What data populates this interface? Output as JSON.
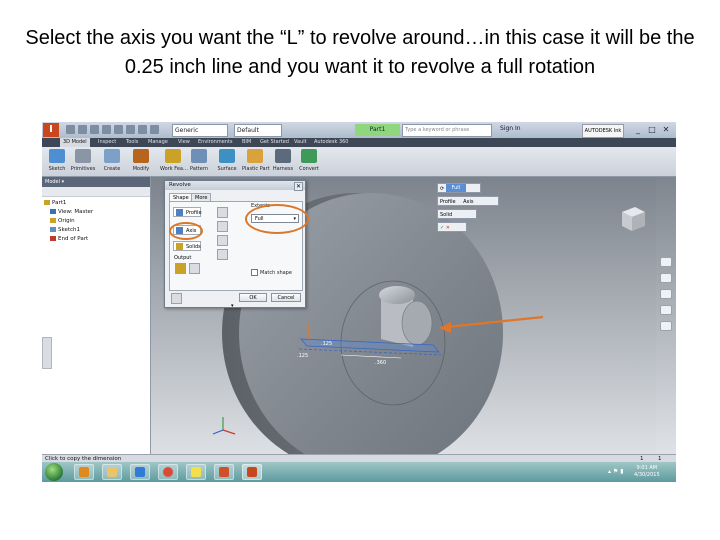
{
  "slide": {
    "title": "Select the axis you want the “L” to revolve around…in this case it will be the 0.25 inch line and you want it to revolve a full rotation"
  },
  "app": {
    "app_button_label": "I",
    "appearance_combo": "Generic",
    "material_combo": "Default",
    "document_title": "Part1",
    "search_placeholder": "Type a keyword or phrase",
    "sign_in": "Sign In",
    "autodesk_button": "AUTODESK Ink",
    "window_controls": [
      "_",
      "□",
      "✕"
    ]
  },
  "tabs": [
    "3D Model",
    "Inspect",
    "Tools",
    "Manage",
    "View",
    "Environments",
    "BIM",
    "Get Started",
    "Vault",
    "Autodesk 360"
  ],
  "ribbon": {
    "buttons": [
      {
        "label": "Sketch",
        "color": "#4d8fd1"
      },
      {
        "label": "Primitives",
        "color": "#8a96a6"
      },
      {
        "label": "Create",
        "color": "#7da0c8"
      },
      {
        "label": "Modify",
        "color": "#b5651d"
      },
      {
        "label": "Work Fea…",
        "color": "#c9a227"
      },
      {
        "label": "Pattern",
        "color": "#6f8fb6"
      },
      {
        "label": "Surface",
        "color": "#3e8fc2"
      },
      {
        "label": "Plastic Part",
        "color": "#d9a23a"
      },
      {
        "label": "Harness",
        "color": "#5b6b7c"
      },
      {
        "label": "Convert",
        "color": "#3f9a5a"
      }
    ]
  },
  "browser": {
    "header": "Model ▾",
    "tree": [
      {
        "label": "Part1",
        "color": "#c9a227"
      },
      {
        "label": "View: Master",
        "color": "#3b6fb6"
      },
      {
        "label": "Origin",
        "color": "#c9a227"
      },
      {
        "label": "Sketch1",
        "color": "#5b8fd0"
      },
      {
        "label": "End of Part",
        "color": "#c0392b"
      }
    ]
  },
  "dialog": {
    "title": "Revolve",
    "close": "✕",
    "tabs": [
      "Shape",
      "More"
    ],
    "profile_label": "Profile",
    "axis_label": "Axis",
    "solids_label": "Solids",
    "output_label": "Output",
    "extents_label": "Extents",
    "extents_value": "Full",
    "match_shape": "Match shape",
    "ok": "OK",
    "cancel": "Cancel"
  },
  "minitoolbar": {
    "full_label": "Full",
    "profile": "Profile",
    "axis": "Axis",
    "solid": "Solid"
  },
  "dimension": {
    "value1": ".125",
    "value2": ".360",
    "value3": ".125"
  },
  "status": {
    "text": "Click to copy the dimension",
    "counts": [
      "1",
      "1"
    ]
  },
  "taskbar": {
    "icons": [
      {
        "name": "outlook",
        "color": "#e08a1e"
      },
      {
        "name": "explorer",
        "color": "#e9c46a"
      },
      {
        "name": "ie",
        "color": "#2f7bd6"
      },
      {
        "name": "chrome",
        "color": "#d94a38"
      },
      {
        "name": "sticky-notes",
        "color": "#f3df4b"
      },
      {
        "name": "powerpoint",
        "color": "#d0502b"
      },
      {
        "name": "inventor",
        "color": "#c8471e"
      }
    ],
    "time": "9:01 AM",
    "date": "4/30/2015"
  }
}
